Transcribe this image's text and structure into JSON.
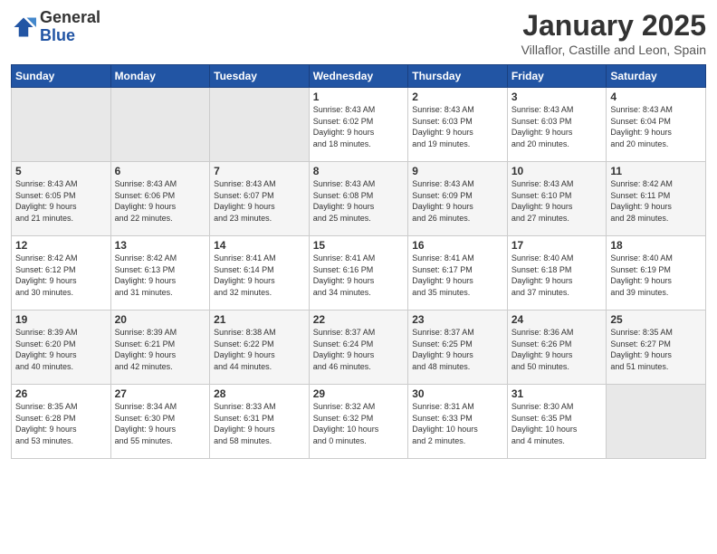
{
  "logo": {
    "general": "General",
    "blue": "Blue"
  },
  "header": {
    "title": "January 2025",
    "subtitle": "Villaflor, Castille and Leon, Spain"
  },
  "weekdays": [
    "Sunday",
    "Monday",
    "Tuesday",
    "Wednesday",
    "Thursday",
    "Friday",
    "Saturday"
  ],
  "weeks": [
    [
      {
        "day": "",
        "info": ""
      },
      {
        "day": "",
        "info": ""
      },
      {
        "day": "",
        "info": ""
      },
      {
        "day": "1",
        "info": "Sunrise: 8:43 AM\nSunset: 6:02 PM\nDaylight: 9 hours\nand 18 minutes."
      },
      {
        "day": "2",
        "info": "Sunrise: 8:43 AM\nSunset: 6:03 PM\nDaylight: 9 hours\nand 19 minutes."
      },
      {
        "day": "3",
        "info": "Sunrise: 8:43 AM\nSunset: 6:03 PM\nDaylight: 9 hours\nand 20 minutes."
      },
      {
        "day": "4",
        "info": "Sunrise: 8:43 AM\nSunset: 6:04 PM\nDaylight: 9 hours\nand 20 minutes."
      }
    ],
    [
      {
        "day": "5",
        "info": "Sunrise: 8:43 AM\nSunset: 6:05 PM\nDaylight: 9 hours\nand 21 minutes."
      },
      {
        "day": "6",
        "info": "Sunrise: 8:43 AM\nSunset: 6:06 PM\nDaylight: 9 hours\nand 22 minutes."
      },
      {
        "day": "7",
        "info": "Sunrise: 8:43 AM\nSunset: 6:07 PM\nDaylight: 9 hours\nand 23 minutes."
      },
      {
        "day": "8",
        "info": "Sunrise: 8:43 AM\nSunset: 6:08 PM\nDaylight: 9 hours\nand 25 minutes."
      },
      {
        "day": "9",
        "info": "Sunrise: 8:43 AM\nSunset: 6:09 PM\nDaylight: 9 hours\nand 26 minutes."
      },
      {
        "day": "10",
        "info": "Sunrise: 8:43 AM\nSunset: 6:10 PM\nDaylight: 9 hours\nand 27 minutes."
      },
      {
        "day": "11",
        "info": "Sunrise: 8:42 AM\nSunset: 6:11 PM\nDaylight: 9 hours\nand 28 minutes."
      }
    ],
    [
      {
        "day": "12",
        "info": "Sunrise: 8:42 AM\nSunset: 6:12 PM\nDaylight: 9 hours\nand 30 minutes."
      },
      {
        "day": "13",
        "info": "Sunrise: 8:42 AM\nSunset: 6:13 PM\nDaylight: 9 hours\nand 31 minutes."
      },
      {
        "day": "14",
        "info": "Sunrise: 8:41 AM\nSunset: 6:14 PM\nDaylight: 9 hours\nand 32 minutes."
      },
      {
        "day": "15",
        "info": "Sunrise: 8:41 AM\nSunset: 6:16 PM\nDaylight: 9 hours\nand 34 minutes."
      },
      {
        "day": "16",
        "info": "Sunrise: 8:41 AM\nSunset: 6:17 PM\nDaylight: 9 hours\nand 35 minutes."
      },
      {
        "day": "17",
        "info": "Sunrise: 8:40 AM\nSunset: 6:18 PM\nDaylight: 9 hours\nand 37 minutes."
      },
      {
        "day": "18",
        "info": "Sunrise: 8:40 AM\nSunset: 6:19 PM\nDaylight: 9 hours\nand 39 minutes."
      }
    ],
    [
      {
        "day": "19",
        "info": "Sunrise: 8:39 AM\nSunset: 6:20 PM\nDaylight: 9 hours\nand 40 minutes."
      },
      {
        "day": "20",
        "info": "Sunrise: 8:39 AM\nSunset: 6:21 PM\nDaylight: 9 hours\nand 42 minutes."
      },
      {
        "day": "21",
        "info": "Sunrise: 8:38 AM\nSunset: 6:22 PM\nDaylight: 9 hours\nand 44 minutes."
      },
      {
        "day": "22",
        "info": "Sunrise: 8:37 AM\nSunset: 6:24 PM\nDaylight: 9 hours\nand 46 minutes."
      },
      {
        "day": "23",
        "info": "Sunrise: 8:37 AM\nSunset: 6:25 PM\nDaylight: 9 hours\nand 48 minutes."
      },
      {
        "day": "24",
        "info": "Sunrise: 8:36 AM\nSunset: 6:26 PM\nDaylight: 9 hours\nand 50 minutes."
      },
      {
        "day": "25",
        "info": "Sunrise: 8:35 AM\nSunset: 6:27 PM\nDaylight: 9 hours\nand 51 minutes."
      }
    ],
    [
      {
        "day": "26",
        "info": "Sunrise: 8:35 AM\nSunset: 6:28 PM\nDaylight: 9 hours\nand 53 minutes."
      },
      {
        "day": "27",
        "info": "Sunrise: 8:34 AM\nSunset: 6:30 PM\nDaylight: 9 hours\nand 55 minutes."
      },
      {
        "day": "28",
        "info": "Sunrise: 8:33 AM\nSunset: 6:31 PM\nDaylight: 9 hours\nand 58 minutes."
      },
      {
        "day": "29",
        "info": "Sunrise: 8:32 AM\nSunset: 6:32 PM\nDaylight: 10 hours\nand 0 minutes."
      },
      {
        "day": "30",
        "info": "Sunrise: 8:31 AM\nSunset: 6:33 PM\nDaylight: 10 hours\nand 2 minutes."
      },
      {
        "day": "31",
        "info": "Sunrise: 8:30 AM\nSunset: 6:35 PM\nDaylight: 10 hours\nand 4 minutes."
      },
      {
        "day": "",
        "info": ""
      }
    ]
  ]
}
